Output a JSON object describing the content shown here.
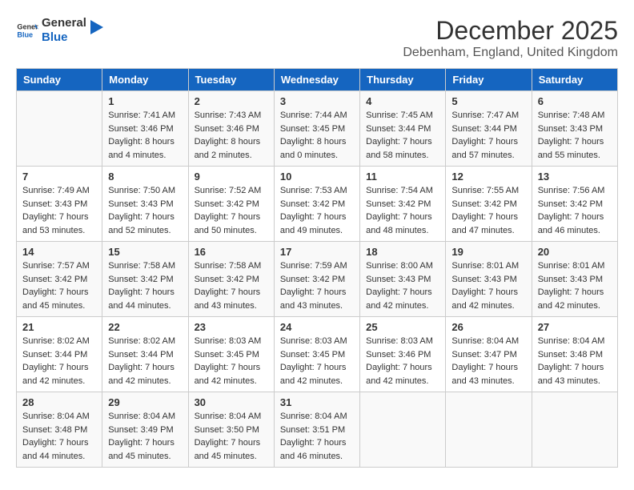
{
  "header": {
    "logo_general": "General",
    "logo_blue": "Blue",
    "month_title": "December 2025",
    "location": "Debenham, England, United Kingdom"
  },
  "days_of_week": [
    "Sunday",
    "Monday",
    "Tuesday",
    "Wednesday",
    "Thursday",
    "Friday",
    "Saturday"
  ],
  "weeks": [
    [
      {
        "day": "",
        "sunrise": "",
        "sunset": "",
        "daylight": ""
      },
      {
        "day": "1",
        "sunrise": "Sunrise: 7:41 AM",
        "sunset": "Sunset: 3:46 PM",
        "daylight": "Daylight: 8 hours and 4 minutes."
      },
      {
        "day": "2",
        "sunrise": "Sunrise: 7:43 AM",
        "sunset": "Sunset: 3:46 PM",
        "daylight": "Daylight: 8 hours and 2 minutes."
      },
      {
        "day": "3",
        "sunrise": "Sunrise: 7:44 AM",
        "sunset": "Sunset: 3:45 PM",
        "daylight": "Daylight: 8 hours and 0 minutes."
      },
      {
        "day": "4",
        "sunrise": "Sunrise: 7:45 AM",
        "sunset": "Sunset: 3:44 PM",
        "daylight": "Daylight: 7 hours and 58 minutes."
      },
      {
        "day": "5",
        "sunrise": "Sunrise: 7:47 AM",
        "sunset": "Sunset: 3:44 PM",
        "daylight": "Daylight: 7 hours and 57 minutes."
      },
      {
        "day": "6",
        "sunrise": "Sunrise: 7:48 AM",
        "sunset": "Sunset: 3:43 PM",
        "daylight": "Daylight: 7 hours and 55 minutes."
      }
    ],
    [
      {
        "day": "7",
        "sunrise": "Sunrise: 7:49 AM",
        "sunset": "Sunset: 3:43 PM",
        "daylight": "Daylight: 7 hours and 53 minutes."
      },
      {
        "day": "8",
        "sunrise": "Sunrise: 7:50 AM",
        "sunset": "Sunset: 3:43 PM",
        "daylight": "Daylight: 7 hours and 52 minutes."
      },
      {
        "day": "9",
        "sunrise": "Sunrise: 7:52 AM",
        "sunset": "Sunset: 3:42 PM",
        "daylight": "Daylight: 7 hours and 50 minutes."
      },
      {
        "day": "10",
        "sunrise": "Sunrise: 7:53 AM",
        "sunset": "Sunset: 3:42 PM",
        "daylight": "Daylight: 7 hours and 49 minutes."
      },
      {
        "day": "11",
        "sunrise": "Sunrise: 7:54 AM",
        "sunset": "Sunset: 3:42 PM",
        "daylight": "Daylight: 7 hours and 48 minutes."
      },
      {
        "day": "12",
        "sunrise": "Sunrise: 7:55 AM",
        "sunset": "Sunset: 3:42 PM",
        "daylight": "Daylight: 7 hours and 47 minutes."
      },
      {
        "day": "13",
        "sunrise": "Sunrise: 7:56 AM",
        "sunset": "Sunset: 3:42 PM",
        "daylight": "Daylight: 7 hours and 46 minutes."
      }
    ],
    [
      {
        "day": "14",
        "sunrise": "Sunrise: 7:57 AM",
        "sunset": "Sunset: 3:42 PM",
        "daylight": "Daylight: 7 hours and 45 minutes."
      },
      {
        "day": "15",
        "sunrise": "Sunrise: 7:58 AM",
        "sunset": "Sunset: 3:42 PM",
        "daylight": "Daylight: 7 hours and 44 minutes."
      },
      {
        "day": "16",
        "sunrise": "Sunrise: 7:58 AM",
        "sunset": "Sunset: 3:42 PM",
        "daylight": "Daylight: 7 hours and 43 minutes."
      },
      {
        "day": "17",
        "sunrise": "Sunrise: 7:59 AM",
        "sunset": "Sunset: 3:42 PM",
        "daylight": "Daylight: 7 hours and 43 minutes."
      },
      {
        "day": "18",
        "sunrise": "Sunrise: 8:00 AM",
        "sunset": "Sunset: 3:43 PM",
        "daylight": "Daylight: 7 hours and 42 minutes."
      },
      {
        "day": "19",
        "sunrise": "Sunrise: 8:01 AM",
        "sunset": "Sunset: 3:43 PM",
        "daylight": "Daylight: 7 hours and 42 minutes."
      },
      {
        "day": "20",
        "sunrise": "Sunrise: 8:01 AM",
        "sunset": "Sunset: 3:43 PM",
        "daylight": "Daylight: 7 hours and 42 minutes."
      }
    ],
    [
      {
        "day": "21",
        "sunrise": "Sunrise: 8:02 AM",
        "sunset": "Sunset: 3:44 PM",
        "daylight": "Daylight: 7 hours and 42 minutes."
      },
      {
        "day": "22",
        "sunrise": "Sunrise: 8:02 AM",
        "sunset": "Sunset: 3:44 PM",
        "daylight": "Daylight: 7 hours and 42 minutes."
      },
      {
        "day": "23",
        "sunrise": "Sunrise: 8:03 AM",
        "sunset": "Sunset: 3:45 PM",
        "daylight": "Daylight: 7 hours and 42 minutes."
      },
      {
        "day": "24",
        "sunrise": "Sunrise: 8:03 AM",
        "sunset": "Sunset: 3:45 PM",
        "daylight": "Daylight: 7 hours and 42 minutes."
      },
      {
        "day": "25",
        "sunrise": "Sunrise: 8:03 AM",
        "sunset": "Sunset: 3:46 PM",
        "daylight": "Daylight: 7 hours and 42 minutes."
      },
      {
        "day": "26",
        "sunrise": "Sunrise: 8:04 AM",
        "sunset": "Sunset: 3:47 PM",
        "daylight": "Daylight: 7 hours and 43 minutes."
      },
      {
        "day": "27",
        "sunrise": "Sunrise: 8:04 AM",
        "sunset": "Sunset: 3:48 PM",
        "daylight": "Daylight: 7 hours and 43 minutes."
      }
    ],
    [
      {
        "day": "28",
        "sunrise": "Sunrise: 8:04 AM",
        "sunset": "Sunset: 3:48 PM",
        "daylight": "Daylight: 7 hours and 44 minutes."
      },
      {
        "day": "29",
        "sunrise": "Sunrise: 8:04 AM",
        "sunset": "Sunset: 3:49 PM",
        "daylight": "Daylight: 7 hours and 45 minutes."
      },
      {
        "day": "30",
        "sunrise": "Sunrise: 8:04 AM",
        "sunset": "Sunset: 3:50 PM",
        "daylight": "Daylight: 7 hours and 45 minutes."
      },
      {
        "day": "31",
        "sunrise": "Sunrise: 8:04 AM",
        "sunset": "Sunset: 3:51 PM",
        "daylight": "Daylight: 7 hours and 46 minutes."
      },
      {
        "day": "",
        "sunrise": "",
        "sunset": "",
        "daylight": ""
      },
      {
        "day": "",
        "sunrise": "",
        "sunset": "",
        "daylight": ""
      },
      {
        "day": "",
        "sunrise": "",
        "sunset": "",
        "daylight": ""
      }
    ]
  ]
}
